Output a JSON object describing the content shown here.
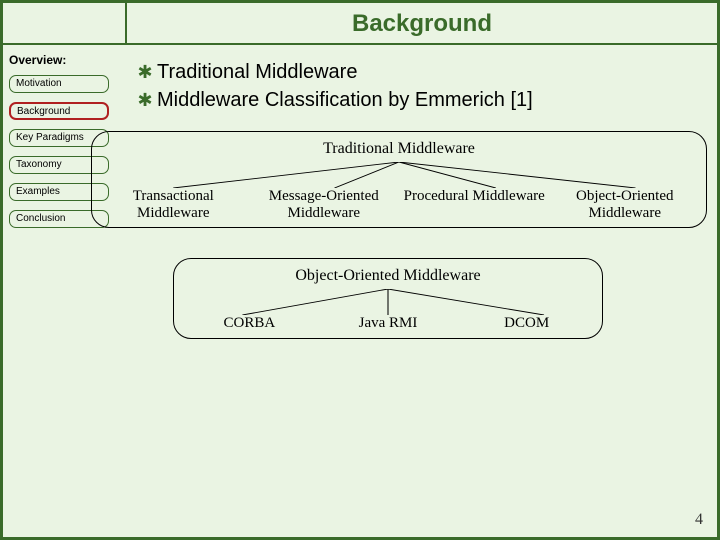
{
  "slide": {
    "title": "Background",
    "page_number": "4"
  },
  "sidebar": {
    "heading": "Overview:",
    "items": [
      {
        "label": "Motivation",
        "active": false
      },
      {
        "label": "Background",
        "active": true
      },
      {
        "label": "Key Paradigms",
        "active": false
      },
      {
        "label": "Taxonomy",
        "active": false
      },
      {
        "label": "Examples",
        "active": false
      },
      {
        "label": "Conclusion",
        "active": false
      }
    ]
  },
  "bullets": [
    "Traditional Middleware",
    "Middleware Classification by Emmerich [1]"
  ],
  "tree_upper": {
    "title": "Traditional Middleware",
    "children": [
      "Transactional Middleware",
      "Message-Oriented Middleware",
      "Procedural Middleware",
      "Object-Oriented Middleware"
    ]
  },
  "tree_lower": {
    "title": "Object-Oriented Middleware",
    "children": [
      "CORBA",
      "Java RMI",
      "DCOM"
    ]
  },
  "chart_data": [
    {
      "type": "tree",
      "title": "Traditional Middleware",
      "root": "Traditional Middleware",
      "children": [
        "Transactional Middleware",
        "Message-Oriented Middleware",
        "Procedural Middleware",
        "Object-Oriented Middleware"
      ]
    },
    {
      "type": "tree",
      "title": "Object-Oriented Middleware",
      "root": "Object-Oriented Middleware",
      "children": [
        "CORBA",
        "Java RMI",
        "DCOM"
      ]
    }
  ]
}
